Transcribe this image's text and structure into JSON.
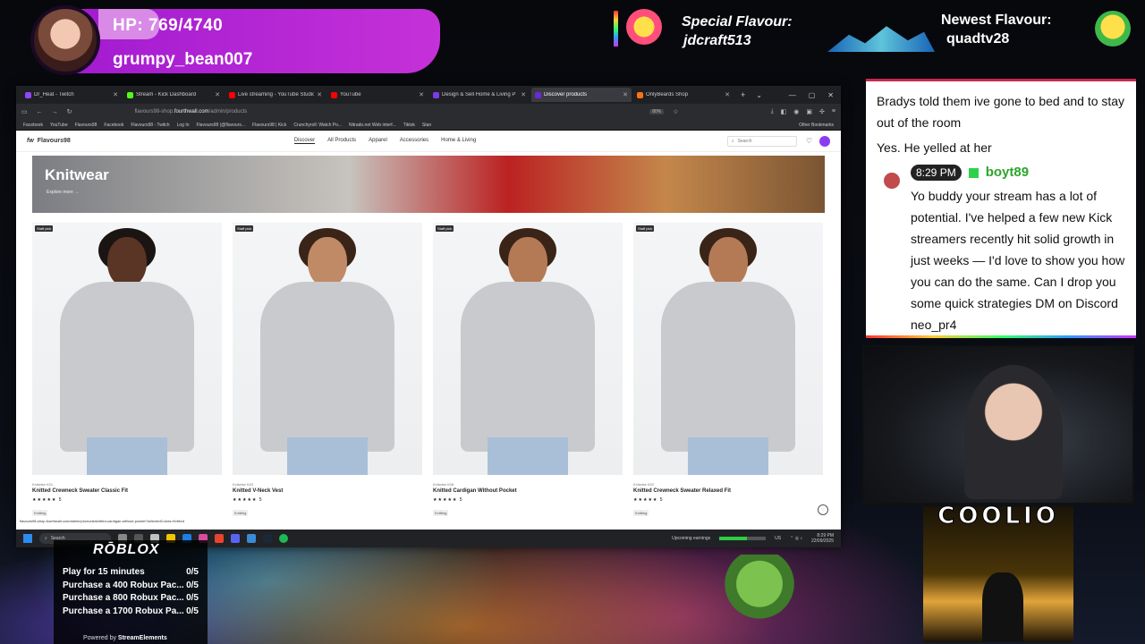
{
  "overlay": {
    "hp_text": "HP: 769/4740",
    "hp_fraction": 0.162,
    "username": "grumpy_bean007",
    "special_label": "Special Flavour:",
    "special_user": "jdcraft513",
    "newest_label": "Newest Flavour:",
    "newest_user": "quadtv28"
  },
  "browser": {
    "tabs": [
      {
        "label": "Dr_Heat - Twitch",
        "color": "#9147ff",
        "active": false
      },
      {
        "label": "Stream - Kick Dashboard",
        "color": "#53fc18",
        "active": false
      },
      {
        "label": "Live streaming - YouTube Studio",
        "color": "#ff0000",
        "active": false
      },
      {
        "label": "YouTube",
        "color": "#ff0000",
        "active": false
      },
      {
        "label": "Design & Sell Home & Living P",
        "color": "#7c3aed",
        "active": false
      },
      {
        "label": "Discover products",
        "color": "#6d28d9",
        "active": true
      },
      {
        "label": "OnlyBeards Shop",
        "color": "#f97316",
        "active": false
      }
    ],
    "url_prefix": "flavours98-shop.",
    "url_domain": "fourthwall.com",
    "url_path": "/admin/products",
    "zoom": "80%",
    "bookmarks": [
      "Facebook",
      "YouTube",
      "Flavours98",
      "Facebook",
      "Flavours98 - Twitch",
      "Log In",
      "Flavours98 (@flavours...",
      "Flavours98 | Kick",
      "Crunchyroll: Watch Po...",
      "Nitrado.net Web interf...",
      "Tiktok",
      "Stan"
    ],
    "other_bookmarks": "Other Bookmarks",
    "status_url": "flavours98-shop.fourthwall.com/admin/products/knitted-cardigan-without-pocket?selectedColors=Knitted"
  },
  "site": {
    "logo_mark": "fw",
    "logo_name": "Flavours98",
    "nav": [
      "Discover",
      "All Products",
      "Apparel",
      "Accessories",
      "Home & Living"
    ],
    "search_placeholder": "Search",
    "hero_title": "Knitwear",
    "hero_link": "Explore more →",
    "products": [
      {
        "badge": "Staff pick",
        "sku": "Knitwise K01",
        "title": "Knitted Crewneck Sweater Classic Fit",
        "stars": "★★★★★ 5",
        "category": "Knitting",
        "skin": "#5a3424",
        "hair": "#1a1412"
      },
      {
        "badge": "Staff pick",
        "sku": "Knitwise K03",
        "title": "Knitted V-Neck Vest",
        "stars": "★★★★★ 5",
        "category": "Knitting",
        "skin": "#c08a66",
        "hair": "#3a2418"
      },
      {
        "badge": "Staff pick",
        "sku": "Knitwise K08",
        "title": "Knitted Cardigan Without Pocket",
        "stars": "★★★★★ 5",
        "category": "Knitting",
        "skin": "#b47a56",
        "hair": "#3a2418"
      },
      {
        "badge": "Staff pick",
        "sku": "Knitwise K02",
        "title": "Knitted Crewneck Sweater Relaxed Fit",
        "stars": "★★★★★ 5",
        "category": "Knitting",
        "skin": "#b47a56",
        "hair": "#3a2418"
      }
    ]
  },
  "taskbar": {
    "search": "Search",
    "upcoming": "Upcoming earnings",
    "lang": "US",
    "time": "8:29 PM",
    "date": "22/09/2025"
  },
  "chat": {
    "line1": "Bradys told them ive gone to bed and to stay out of the room",
    "line2": "Yes. He yelled at her",
    "time": "8:29 PM",
    "user": "boyt89",
    "message": "Yo buddy your stream has a lot of potential. I've helped a few new Kick streamers recently hit solid growth in just weeks — I'd love to show you how you can do the same. Can I drop you some quick strategies DM on Discord neo_pr4"
  },
  "coolio": {
    "title": "COOLIO"
  },
  "roblox": {
    "logo": "RŌBLOX",
    "goals": [
      {
        "label": "Play for 15 minutes",
        "progress": "0/5"
      },
      {
        "label": "Purchase a 400 Robux Pac...",
        "progress": "0/5"
      },
      {
        "label": "Purchase a 800 Robux Pac...",
        "progress": "0/5"
      },
      {
        "label": "Purchase a 1700 Robux Pa...",
        "progress": "0/5"
      }
    ],
    "powered_prefix": "Powered by",
    "powered_brand": "StreamElements"
  }
}
